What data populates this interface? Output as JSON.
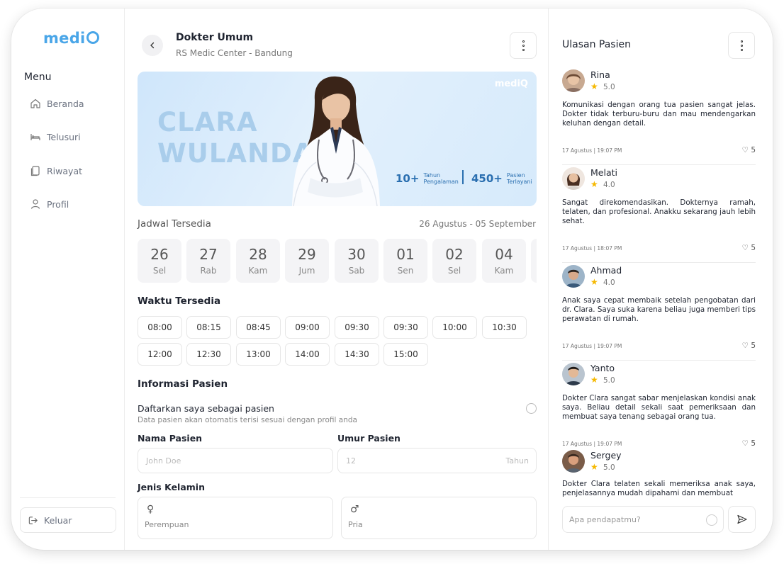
{
  "brand": {
    "logo_text": "medi",
    "logo_suffix": "Q"
  },
  "sidebar": {
    "menu_title": "Menu",
    "items": [
      {
        "label": "Beranda",
        "icon": "home-icon"
      },
      {
        "label": "Telusuri",
        "icon": "bed-icon"
      },
      {
        "label": "Riwayat",
        "icon": "history-icon"
      },
      {
        "label": "Profil",
        "icon": "user-icon"
      }
    ],
    "logout_label": "Keluar"
  },
  "header": {
    "title": "Dokter Umum",
    "subtitle": "RS Medic Center - Bandung"
  },
  "banner": {
    "first_name": "CLARA",
    "last_name": "WULANDA",
    "logo": "mediQ",
    "stats": [
      {
        "value": "10+",
        "label_line1": "Tahun",
        "label_line2": "Pengalaman"
      },
      {
        "value": "450+",
        "label_line1": "Pasien",
        "label_line2": "Terlayani"
      }
    ]
  },
  "schedule": {
    "title": "Jadwal Tersedia",
    "range": "26 Agustus - 05 September",
    "dates": [
      {
        "day": "26",
        "weekday": "Sel"
      },
      {
        "day": "27",
        "weekday": "Rab"
      },
      {
        "day": "28",
        "weekday": "Kam"
      },
      {
        "day": "29",
        "weekday": "Jum"
      },
      {
        "day": "30",
        "weekday": "Sab"
      },
      {
        "day": "01",
        "weekday": "Sen"
      },
      {
        "day": "02",
        "weekday": "Sel"
      },
      {
        "day": "04",
        "weekday": "Kam"
      }
    ]
  },
  "times": {
    "title": "Waktu Tersedia",
    "slots": [
      "08:00",
      "08:15",
      "08:45",
      "09:00",
      "09:30",
      "09:30",
      "10:00",
      "10:30",
      "12:00",
      "12:30",
      "13:00",
      "14:00",
      "14:30",
      "15:00"
    ]
  },
  "patient": {
    "title": "Informasi Pasien",
    "register_label": "Daftarkan saya sebagai pasien",
    "register_hint": "Data pasien akan otomatis terisi sesuai dengan profil anda",
    "name_label": "Nama Pasien",
    "name_placeholder": "John Doe",
    "age_label": "Umur Pasien",
    "age_placeholder": "12",
    "age_suffix": "Tahun",
    "gender_label": "Jenis Kelamin",
    "gender_options": [
      {
        "symbol": "♀",
        "label": "Perempuan"
      },
      {
        "symbol": "♂",
        "label": "Pria"
      }
    ]
  },
  "reviews": {
    "title": "Ulasan Pasien",
    "items": [
      {
        "name": "Rina",
        "rating": "5.0",
        "text": "Komunikasi dengan orang tua pasien sangat jelas. Dokter tidak terburu-buru dan mau mendengarkan keluhan dengan detail.",
        "date": "17 Agustus | 19:07 PM",
        "likes": "5"
      },
      {
        "name": "Melati",
        "rating": "4.0",
        "text": "Sangat direkomendasikan. Dokternya ramah, telaten, dan profesional. Anakku sekarang jauh lebih sehat.",
        "date": "17 Agustus | 18:07 PM",
        "likes": "5"
      },
      {
        "name": "Ahmad",
        "rating": "4.0",
        "text": "Anak saya cepat membaik setelah pengobatan dari dr. Clara. Saya suka karena beliau juga memberi tips perawatan di rumah.",
        "date": "17 Agustus | 19:07 PM",
        "likes": "5"
      },
      {
        "name": "Yanto",
        "rating": "5.0",
        "text": "Dokter Clara sangat sabar menjelaskan kondisi anak saya. Beliau detail sekali saat pemeriksaan dan membuat saya tenang sebagai orang tua.",
        "date": "17 Agustus | 19:07 PM",
        "likes": "5"
      },
      {
        "name": "Sergey",
        "rating": "5.0",
        "text": "Dokter Clara telaten sekali memeriksa anak saya, penjelasannya mudah dipahami dan membuat"
      }
    ],
    "comment_placeholder": "Apa pendapatmu?"
  },
  "colors": {
    "accent": "#4aa6e8",
    "banner_text": "#2a6fb0",
    "star": "#f5b800"
  }
}
